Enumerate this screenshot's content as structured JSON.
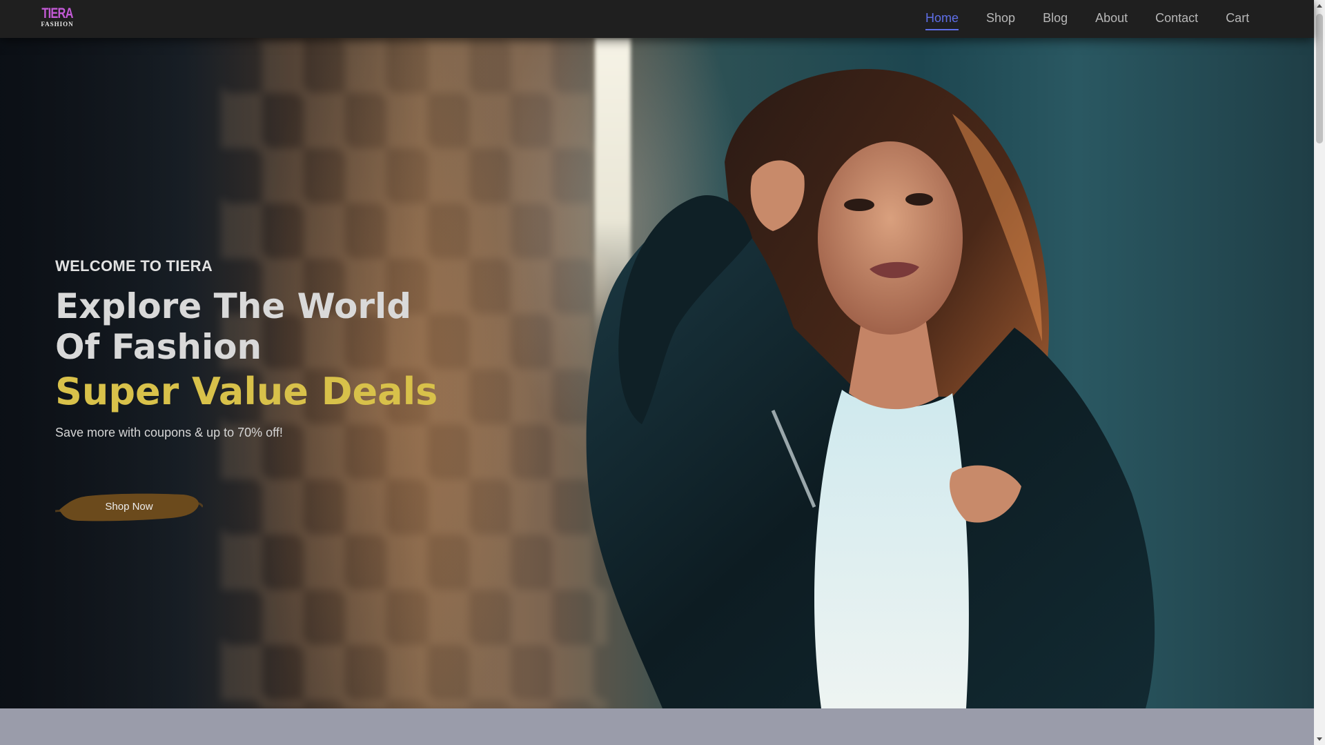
{
  "brand": {
    "logo_top": "TIERA",
    "logo_bottom": "FASHION",
    "accent_color": "#c35ad6"
  },
  "nav": {
    "items": [
      {
        "label": "Home",
        "active": true
      },
      {
        "label": "Shop",
        "active": false
      },
      {
        "label": "Blog",
        "active": false
      },
      {
        "label": "About",
        "active": false
      },
      {
        "label": "Contact",
        "active": false
      },
      {
        "label": "Cart",
        "active": false
      }
    ],
    "active_color": "#5f6fe8"
  },
  "hero": {
    "welcome": "WELCOME TO TIERA",
    "headline_line1": "Explore The World",
    "headline_line2": "Of Fashion",
    "accent_headline": "Super Value Deals",
    "accent_color": "#d8c14a",
    "subtext": "Save more with coupons & up to 70% off!",
    "button_label": "Shop Now",
    "button_color": "#6b4a1c",
    "image": "woman-in-black-leather-jacket-photo"
  }
}
